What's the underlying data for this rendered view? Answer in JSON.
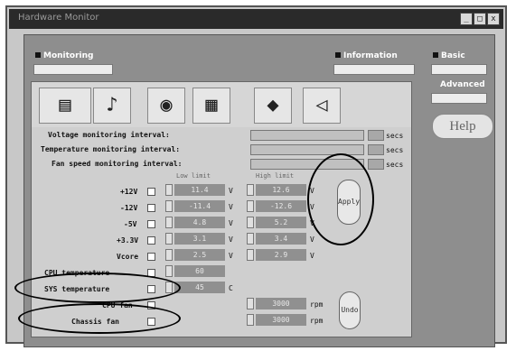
{
  "window": {
    "title": "Hardware Monitor",
    "min": "_",
    "max": "□",
    "close": "x"
  },
  "tabs": {
    "monitoring": "Monitoring",
    "information": "Information",
    "basic": "Basic",
    "advanced": "Advanced",
    "help": "Help"
  },
  "intervals": [
    {
      "label": "Voltage monitoring interval:",
      "unit": "secs"
    },
    {
      "label": "Temperature monitoring interval:",
      "unit": "secs"
    },
    {
      "label": "Fan speed monitoring interval:",
      "unit": "secs"
    }
  ],
  "columns": {
    "low": "Low limit",
    "high": "High limit"
  },
  "rows": [
    {
      "label": "+12V",
      "low": "11.4",
      "high": "12.6",
      "unit": "V"
    },
    {
      "label": "-12V",
      "low": "-11.4",
      "high": "-12.6",
      "unit": "V"
    },
    {
      "label": "-5V",
      "low": "4.8",
      "high": "5.2",
      "unit": "V"
    },
    {
      "label": "+3.3V",
      "low": "3.1",
      "high": "3.4",
      "unit": "V"
    },
    {
      "label": "Vcore",
      "low": "2.5",
      "high": "2.9",
      "unit": "V"
    },
    {
      "label": "CPU temperature",
      "low": "60",
      "high": "",
      "unit": ""
    },
    {
      "label": "SYS temperature",
      "low": "45",
      "high": "",
      "unit": "C"
    },
    {
      "label": "CPU fan",
      "low": "",
      "high": "3000",
      "unit": "rpm"
    },
    {
      "label": "Chassis fan",
      "low": "",
      "high": "3000",
      "unit": "rpm"
    }
  ],
  "pill_top": "Apply",
  "pill_bottom": "Undo",
  "icons": [
    "board-icon",
    "thermometer-icon",
    "fan-icon",
    "chip-icon",
    "disk-icon",
    "speaker-icon"
  ]
}
